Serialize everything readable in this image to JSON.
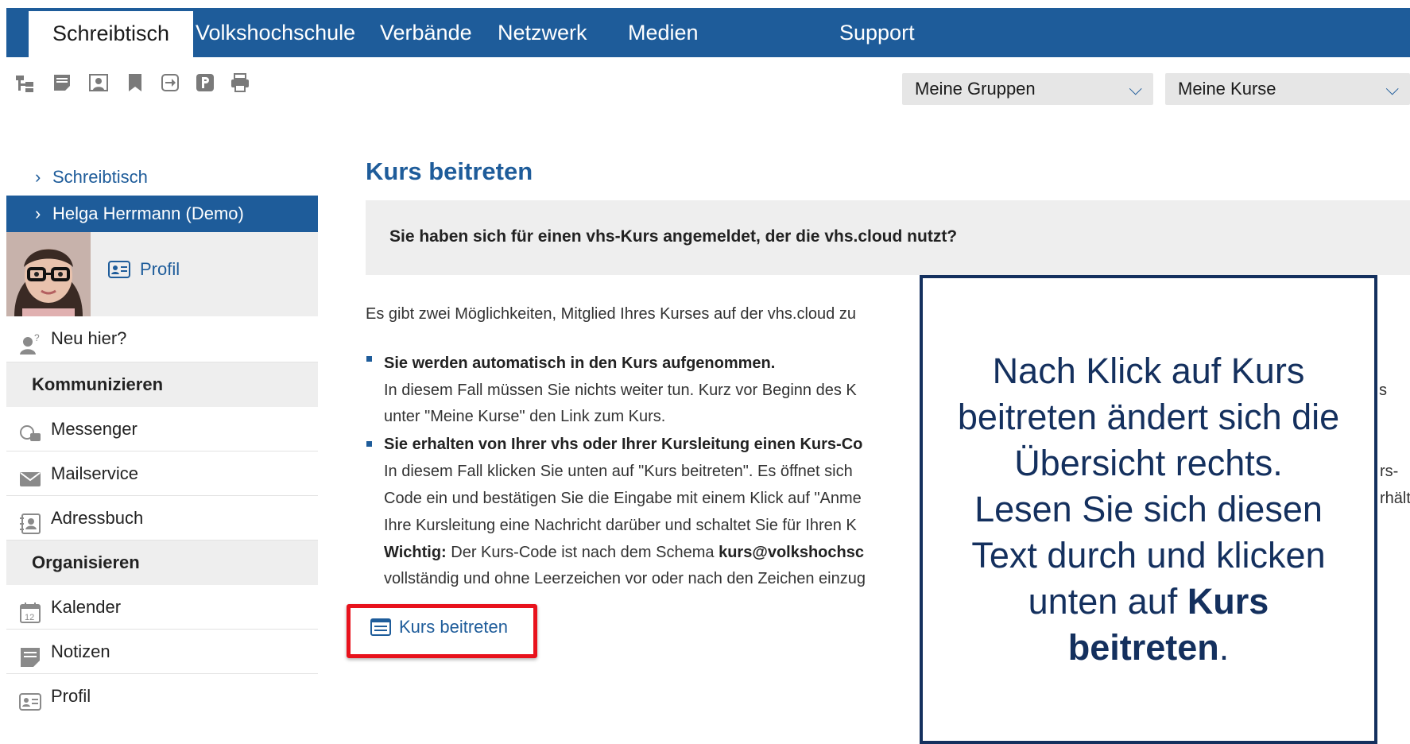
{
  "nav": {
    "tabs": [
      {
        "label": "Schreibtisch"
      },
      {
        "label": "Volkshochschule"
      },
      {
        "label": "Verbände"
      },
      {
        "label": "Netzwerk"
      },
      {
        "label": "Medien"
      },
      {
        "label": "Support"
      }
    ],
    "active_tab": "Schreibtisch"
  },
  "toolbar": {
    "icons": [
      "sitemap-icon",
      "note-icon",
      "users-icon",
      "bookmark-icon",
      "sign-in-icon",
      "parking-icon",
      "print-icon"
    ]
  },
  "selects": {
    "groups": "Meine Gruppen",
    "courses": "Meine Kurse"
  },
  "sidebar": {
    "link_desk": "Schreibtisch",
    "link_user": "Helga Herrmann (Demo)",
    "profile_link": "Profil",
    "new_here": "Neu hier?",
    "section_communicate": "Kommunizieren",
    "messenger": "Messenger",
    "mailservice": "Mailservice",
    "addressbook": "Adressbuch",
    "section_organize": "Organisieren",
    "calendar": "Kalender",
    "calendar_day": "12",
    "notes": "Notizen",
    "profile": "Profil"
  },
  "main": {
    "title": "Kurs beitreten",
    "info_question": "Sie haben sich für einen vhs-Kurs angemeldet, der die vhs.cloud nutzt?",
    "intro": "Es gibt zwei Möglichkeiten, Mitglied Ihres Kurses auf der vhs.cloud zu",
    "option1_title": "Sie werden automatisch in den Kurs aufgenommen.",
    "option1_line1": "In diesem Fall müssen Sie nichts weiter tun. Kurz vor Beginn des K",
    "option1_line1_tail": "s",
    "option1_line2": "unter \"Meine Kurse\" den Link zum Kurs.",
    "option2_title": "Sie erhalten von Ihrer vhs oder Ihrer Kursleitung einen Kurs-Co",
    "option2_line1": "In diesem Fall klicken Sie unten auf \"Kurs beitreten\". Es öffnet sich",
    "option2_line1_tail": "rs-",
    "option2_line2": "Code ein und bestätigen Sie die Eingabe mit einem Klick auf \"Anme",
    "option2_line2_tail": "rhält",
    "option2_line3": "Ihre Kursleitung eine Nachricht darüber und schaltet Sie für Ihren K",
    "important_label": "Wichtig:",
    "important_text": " Der Kurs-Code ist nach dem Schema ",
    "important_code": "kurs@volkshochsc",
    "option2_line5": "vollständig und ohne Leerzeichen vor oder nach den Zeichen einzug",
    "join_button": "Kurs beitreten"
  },
  "callout": {
    "line1": "Nach Klick auf Kurs",
    "line2": "beitreten ändert sich die",
    "line3": "Übersicht rechts.",
    "line4": "Lesen Sie sich diesen",
    "line5": "Text durch und klicken",
    "line6_prefix": "unten auf ",
    "line6_bold": "Kurs",
    "line7_bold": "beitreten",
    "line7_suffix": "."
  },
  "colors": {
    "brand": "#1e5c9a",
    "highlight": "#e8121c",
    "callout_border": "#14305e"
  }
}
